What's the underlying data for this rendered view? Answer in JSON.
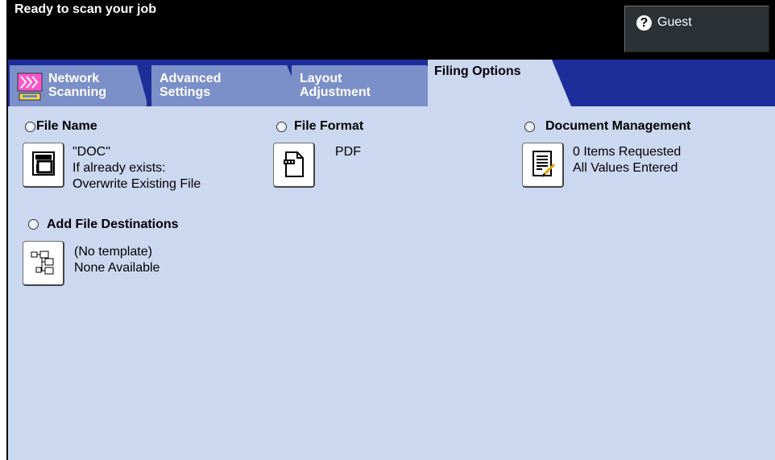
{
  "header": {
    "status_text": "Ready to scan your job",
    "user_icon": "help-question-icon",
    "user_label": "Guest"
  },
  "tabs": [
    {
      "line1": "Network",
      "line2": "Scanning",
      "icon": "network-scanning-icon"
    },
    {
      "line1": "Advanced",
      "line2": "Settings"
    },
    {
      "line1": "Layout",
      "line2": "Adjustment"
    },
    {
      "line1": "Filing Options",
      "line2": "",
      "active": true
    }
  ],
  "filing": {
    "file_name": {
      "title": "File Name",
      "line1": "\"DOC\"",
      "line2": "If already exists:",
      "line3": "Overwrite Existing File",
      "icon": "file-name-icon"
    },
    "file_format": {
      "title": "File Format",
      "line1": "PDF",
      "icon": "document-icon"
    },
    "document_management": {
      "title": "Document Management",
      "line1": "0 Items Requested",
      "line2": "All Values Entered",
      "icon": "document-edit-icon"
    },
    "file_destinations": {
      "title": "Add File Destinations",
      "line1": "(No template)",
      "line2": "None Available",
      "icon": "destinations-tree-icon"
    }
  },
  "colors": {
    "tab_bar": "#1d2d9a",
    "tab_inactive": "#7b8fc8",
    "panel": "#ccd8f0",
    "header": "#000000"
  }
}
